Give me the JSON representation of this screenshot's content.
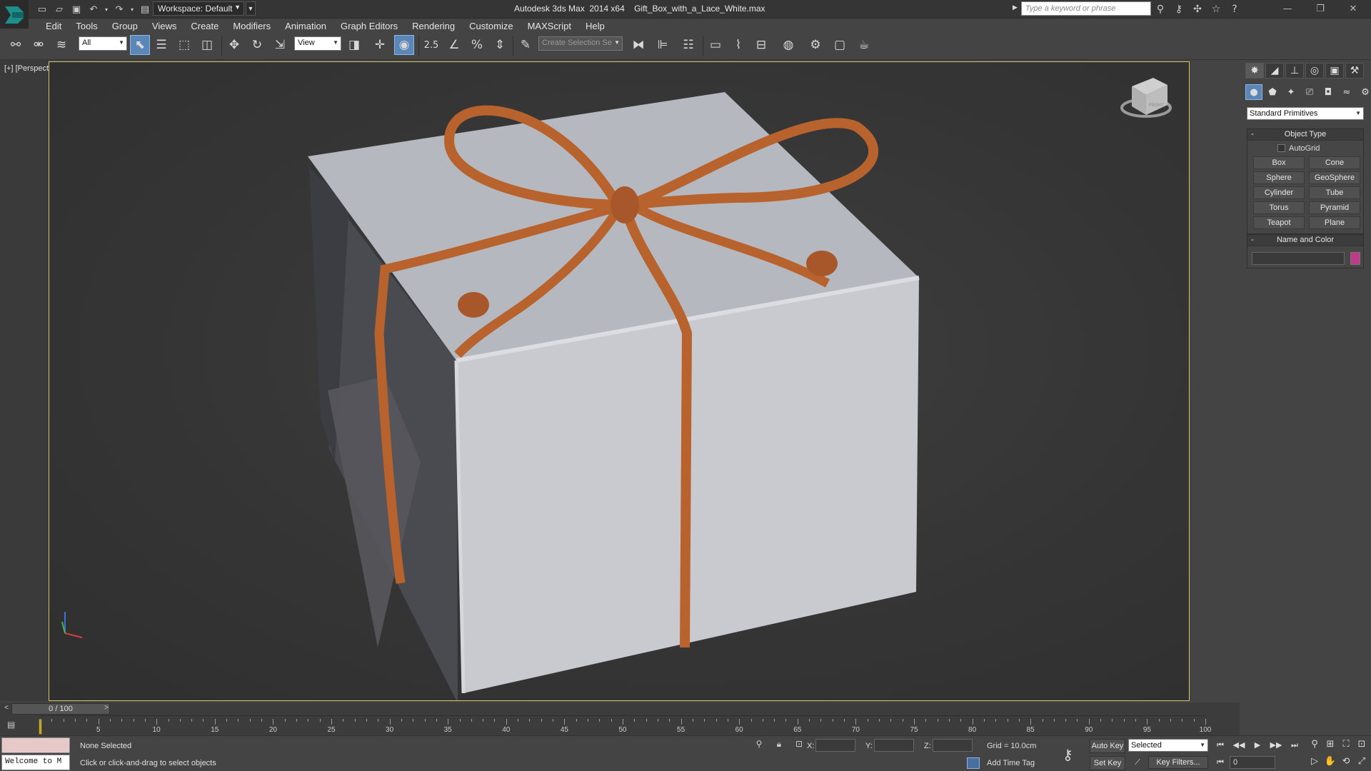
{
  "titlebar": {
    "workspace_label": "Workspace: Default",
    "window_title": "Autodesk 3ds Max  2014 x64    Gift_Box_with_a_Lace_White.max",
    "search_placeholder": "Type a keyword or phrase",
    "quick_access_icons": [
      "new-file-icon",
      "open-file-icon",
      "save-icon",
      "undo-icon",
      "redo-icon",
      "project-folder-icon"
    ],
    "info_icons": [
      "binoculars-icon",
      "search-icon",
      "communication-icon",
      "favorites-star-icon",
      "help-icon"
    ],
    "window_controls": [
      "minimize-icon",
      "restore-icon",
      "close-icon"
    ]
  },
  "menubar": {
    "items": [
      "Edit",
      "Tools",
      "Group",
      "Views",
      "Create",
      "Modifiers",
      "Animation",
      "Graph Editors",
      "Rendering",
      "Customize",
      "MAXScript",
      "Help"
    ]
  },
  "toolbar": {
    "filter_value": "All",
    "ref_coord_value": "View",
    "snap_label": "2.5",
    "selection_set_placeholder": "Create Selection Se",
    "active_tool": "select-object"
  },
  "viewport": {
    "label": "[+] [Perspective ] [Shaded ]",
    "viewcube_label": "FRONT"
  },
  "command_panel": {
    "tabs": [
      "create-tab-icon",
      "modify-tab-icon",
      "hierarchy-tab-icon",
      "motion-tab-icon",
      "display-tab-icon",
      "utilities-tab-icon"
    ],
    "categories": [
      "geometry-icon",
      "shapes-icon",
      "lights-icon",
      "cameras-icon",
      "helpers-icon",
      "space-warps-icon",
      "systems-icon"
    ],
    "primitive_type": "Standard Primitives",
    "object_type": {
      "title": "Object Type",
      "autogrid_label": "AutoGrid",
      "buttons": [
        "Box",
        "Cone",
        "Sphere",
        "GeoSphere",
        "Cylinder",
        "Tube",
        "Torus",
        "Pyramid",
        "Teapot",
        "Plane"
      ]
    },
    "name_and_color": {
      "title": "Name and Color",
      "name_value": "",
      "color": "#c03a8a"
    }
  },
  "timeline": {
    "frame_counter": "0 / 100",
    "ticks": [
      "5",
      "10",
      "15",
      "20",
      "25",
      "30",
      "35",
      "40",
      "45",
      "50",
      "55",
      "60",
      "65",
      "70",
      "75",
      "80",
      "85",
      "90",
      "95",
      "100"
    ],
    "current_frame": 0,
    "total_frames": 100
  },
  "statusbar": {
    "listener_text": "Welcome to M",
    "selection_status": "None Selected",
    "prompt": "Click or click-and-drag to select objects",
    "x_label": "X:",
    "y_label": "Y:",
    "z_label": "Z:",
    "grid_label": "Grid = 10.0cm",
    "add_time_tag": "Add Time Tag",
    "auto_key": "Auto Key",
    "set_key": "Set Key",
    "key_mode_value": "Selected",
    "key_filters": "Key Filters...",
    "frame_value": "0"
  },
  "colors": {
    "viewport_border": "#d8c46b",
    "ribbon": "#b8632e",
    "box_face": "#c9cacf",
    "accent_blue": "#5b86b8"
  }
}
